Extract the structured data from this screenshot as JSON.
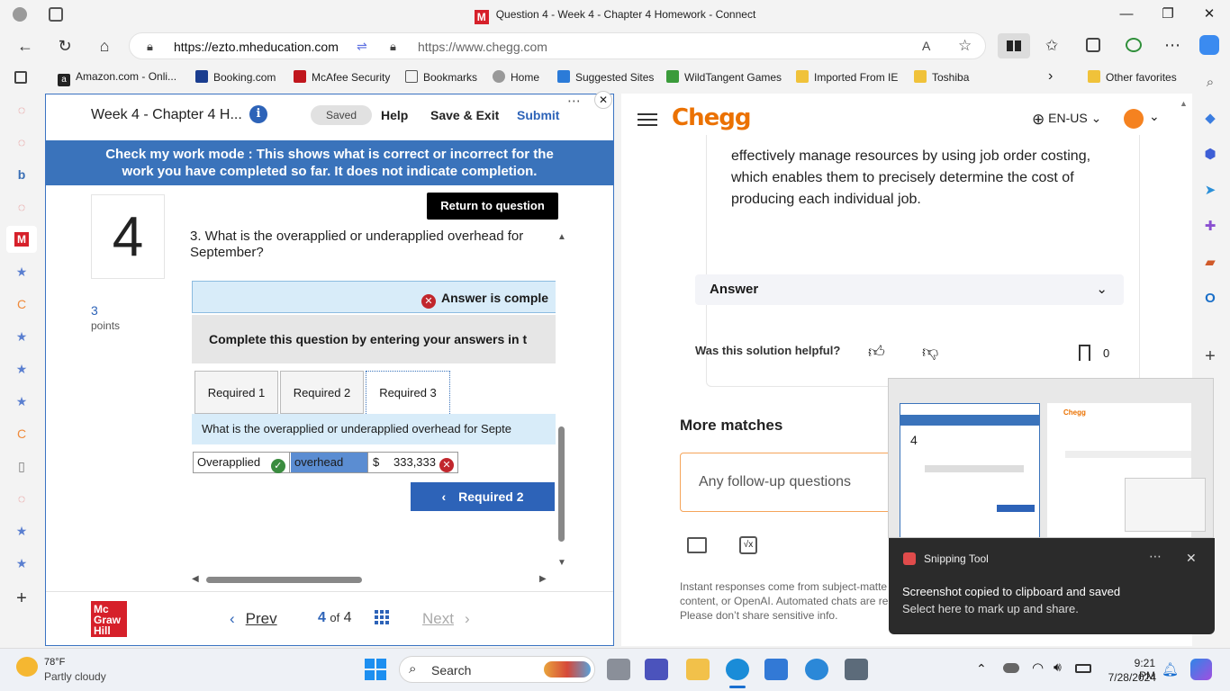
{
  "window": {
    "title": "Question 4 - Week 4 - Chapter 4 Homework - Connect"
  },
  "address": {
    "url_left": "https://ezto.mheducation.com",
    "url_right": "https://www.chegg.com"
  },
  "bookmarks": [
    "Amazon.com - Onli...",
    "Booking.com",
    "McAfee Security",
    "Bookmarks",
    "Home",
    "Suggested Sites",
    "WildTangent Games",
    "Imported From IE",
    "Toshiba",
    "Other favorites"
  ],
  "connect": {
    "title": "Week 4 - Chapter 4 H...",
    "saved": "Saved",
    "help": "Help",
    "save_exit": "Save & Exit",
    "submit": "Submit",
    "banner_line1": "Check my work mode : This shows what is correct or incorrect for the",
    "banner_line2": "work you have completed so far. It does not indicate completion.",
    "return_btn": "Return to question",
    "question_number": "4",
    "points_value": "3",
    "points_label": "points",
    "question_text": "3. What is the overapplied or underapplied overhead for September?",
    "answer_status": "Answer is comple",
    "instruction": "Complete this question by entering your answers in t",
    "tabs": [
      "Required 1",
      "Required 2",
      "Required 3"
    ],
    "sub_question": "What is the overapplied or underapplied overhead for Septe",
    "row": {
      "label": "Overapplied",
      "desc": "overhead",
      "currency": "$",
      "amount": "333,333"
    },
    "back_btn": "Required 2",
    "prev": "Prev",
    "page_current": "4",
    "page_of": "of",
    "page_total": "4",
    "next": "Next",
    "logo": "Mc Graw Hill"
  },
  "chegg": {
    "logo": "Chegg",
    "lang": "EN-US",
    "answer_text": "effectively manage resources by using job order costing, which enables them to precisely determine the cost of producing each individual job.",
    "answer_label": "Answer",
    "helpful": "Was this solution helpful?",
    "bookmark_count": "0",
    "more_matches": "More matches",
    "followup_placeholder": "Any follow-up questions",
    "disclaimer": "Instant responses come from subject-matte content, or OpenAI. Automated chats are re Please don’t share sensitive info."
  },
  "toast": {
    "app": "Snipping Tool",
    "line1": "Screenshot copied to clipboard and saved",
    "line2": "Select here to mark up and share."
  },
  "taskbar": {
    "temp": "78°F",
    "weather": "Partly cloudy",
    "search": "Search",
    "time": "9:21 PM",
    "date": "7/28/2024"
  },
  "colors": {
    "connect_blue": "#3a73bb",
    "chegg_orange": "#eb7100",
    "error_red": "#c1272d",
    "ok_green": "#3a8c3f"
  }
}
